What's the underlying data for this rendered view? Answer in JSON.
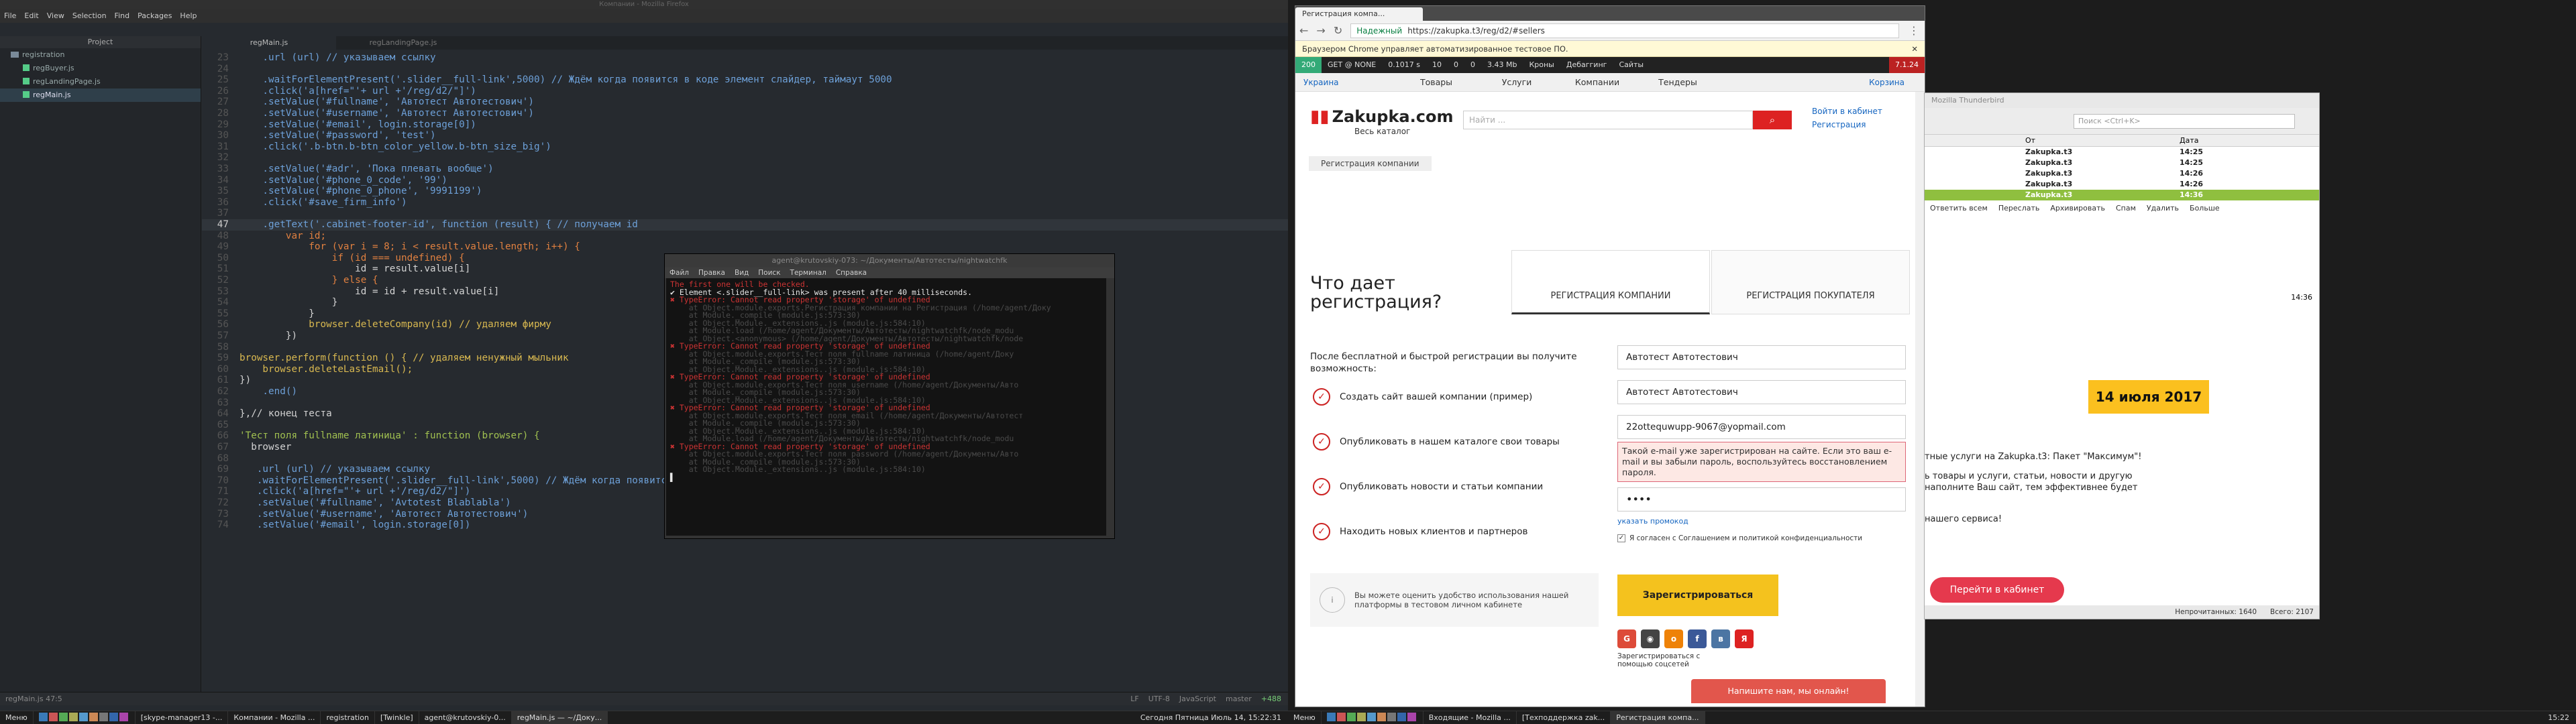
{
  "atom": {
    "window_title": "Компании - Mozilla Firefox",
    "menu": [
      "File",
      "Edit",
      "View",
      "Selection",
      "Find",
      "Packages",
      "Help"
    ],
    "tree_title": "Project",
    "tree": {
      "folder": "registration",
      "files": [
        "regBuyer.js",
        "regLandingPage.js",
        "regMain.js"
      ]
    },
    "tabs": [
      "regMain.js",
      "regLandingPage.js"
    ],
    "status_left": "regMain.js   47:5",
    "status_right": [
      "LF",
      "UTF-8",
      "JavaScript",
      "master",
      "+488"
    ],
    "code": [
      {
        "n": "23",
        "t": "    .url (url) // указываем ссылку"
      },
      {
        "n": "24",
        "t": ""
      },
      {
        "n": "25",
        "t": "    .waitForElementPresent('.slider__full-link',5000) // Ждём когда появится в коде элемент слайдер, таймаут 5000"
      },
      {
        "n": "26",
        "t": "    .click('a[href=\"'+ url +'/reg/d2/\"]')"
      },
      {
        "n": "27",
        "t": "    .setValue('#fullname', 'Автотест Автотестович')"
      },
      {
        "n": "28",
        "t": "    .setValue('#username', 'Автотест Автотестович')"
      },
      {
        "n": "29",
        "t": "    .setValue('#email', login.storage[0])"
      },
      {
        "n": "30",
        "t": "    .setValue('#password', 'test')"
      },
      {
        "n": "31",
        "t": "    .click('.b-btn.b-btn_color_yellow.b-btn_size_big')"
      },
      {
        "n": "32",
        "t": ""
      },
      {
        "n": "33",
        "t": "    .setValue('#adr', 'Пока плевать вообще')"
      },
      {
        "n": "34",
        "t": "    .setValue('#phone_0_code', '99')"
      },
      {
        "n": "35",
        "t": "    .setValue('#phone_0_phone', '9991199')"
      },
      {
        "n": "36",
        "t": "    .click('#save_firm_info')"
      },
      {
        "n": "37",
        "t": ""
      },
      {
        "n": "47",
        "t": "    .getText('.cabinet-footer-id', function (result) { // получаем id"
      },
      {
        "n": "48",
        "t": "        var id;"
      },
      {
        "n": "49",
        "t": "            for (var i = 8; i < result.value.length; i++) {"
      },
      {
        "n": "50",
        "t": "                if (id === undefined) {"
      },
      {
        "n": "51",
        "t": "                    id = result.value[i]"
      },
      {
        "n": "52",
        "t": "                } else {"
      },
      {
        "n": "53",
        "t": "                    id = id + result.value[i]"
      },
      {
        "n": "54",
        "t": "                }"
      },
      {
        "n": "55",
        "t": "            }"
      },
      {
        "n": "56",
        "t": "            browser.deleteCompany(id) // удаляем фирму"
      },
      {
        "n": "57",
        "t": "        })"
      },
      {
        "n": "58",
        "t": ""
      },
      {
        "n": "59",
        "t": "browser.perform(function () { // удаляем ненужный мыльник"
      },
      {
        "n": "60",
        "t": "    browser.deleteLastEmail();"
      },
      {
        "n": "61",
        "t": "})"
      },
      {
        "n": "62",
        "t": "    .end()"
      },
      {
        "n": "63",
        "t": ""
      },
      {
        "n": "64",
        "t": "},// конец теста"
      },
      {
        "n": "65",
        "t": ""
      },
      {
        "n": "66",
        "t": "'Тест поля fullname латиница' : function (browser) {"
      },
      {
        "n": "67",
        "t": "  browser"
      },
      {
        "n": "68",
        "t": ""
      },
      {
        "n": "69",
        "t": "   .url (url) // указываем ссылку"
      },
      {
        "n": "70",
        "t": "   .waitForElementPresent('.slider__full-link',5000) // Ждём когда появится в коде элемент слайдер, таймаут 5000"
      },
      {
        "n": "71",
        "t": "   .click('a[href=\"'+ url +'/reg/d2/\"]')"
      },
      {
        "n": "72",
        "t": "   .setValue('#fullname', 'Avtotest Blablabla')"
      },
      {
        "n": "73",
        "t": "   .setValue('#username', 'Автотест Автотестович')"
      },
      {
        "n": "74",
        "t": "   .setValue('#email', login.storage[0])"
      }
    ]
  },
  "terminal": {
    "title": "agent@krutovskiy-073: ~/Документы/Автотесты/nightwatchfk",
    "menu": [
      "Файл",
      "Правка",
      "Вид",
      "Поиск",
      "Терминал",
      "Справка"
    ],
    "lines": [
      {
        "c": "err",
        "t": "The first one will be checked."
      },
      {
        "c": "ok",
        "t": "✔ Element <.slider__full-link> was present after 40 milliseconds."
      },
      {
        "c": "err",
        "t": "✖ TypeError: Cannot read property 'storage' of undefined"
      },
      {
        "c": "dim",
        "t": "    at Object.module.exports.Регистрация компании на Регистрация (/home/agent/Доку"
      },
      {
        "c": "dim",
        "t": "    at Module._compile (module.js:573:30)"
      },
      {
        "c": "dim",
        "t": "    at Object.Module._extensions..js (module.js:584:10)"
      },
      {
        "c": "dim",
        "t": "    at Module.load (/home/agent/Документы/Автотесты/nightwatchfk/node_modu"
      },
      {
        "c": "dim",
        "t": "    at Object.<anonymous> (/home/agent/Документы/Автотесты/nightwatchfk/node"
      },
      {
        "c": "err",
        "t": "✖ TypeError: Cannot read property 'storage' of undefined"
      },
      {
        "c": "dim",
        "t": "    at Object.module.exports.Тест поля fullname латиница (/home/agent/Доку"
      },
      {
        "c": "dim",
        "t": "    at Module._compile (module.js:573:30)"
      },
      {
        "c": "dim",
        "t": "    at Object.Module._extensions..js (module.js:584:10)"
      },
      {
        "c": "err",
        "t": "✖ TypeError: Cannot read property 'storage' of undefined"
      },
      {
        "c": "dim",
        "t": "    at Object.module.exports.Тест поля username (/home/agent/Документы/Авто"
      },
      {
        "c": "dim",
        "t": "    at Module._compile (module.js:573:30)"
      },
      {
        "c": "dim",
        "t": "    at Object.Module._extensions..js (module.js:584:10)"
      },
      {
        "c": "err",
        "t": "✖ TypeError: Cannot read property 'storage' of undefined"
      },
      {
        "c": "dim",
        "t": "    at Object.module.exports.Тест поля email (/home/agent/Документы/Автотест"
      },
      {
        "c": "dim",
        "t": "    at Module._compile (module.js:573:30)"
      },
      {
        "c": "dim",
        "t": "    at Object.Module._extensions..js (module.js:584:10)"
      },
      {
        "c": "dim",
        "t": "    at Module.load (/home/agent/Документы/Автотесты/nightwatchfk/node_modu"
      },
      {
        "c": "err",
        "t": "✖ TypeError: Cannot read property 'storage' of undefined"
      },
      {
        "c": "dim",
        "t": "    at Object.module.exports.Тест поля password (/home/agent/Документы/Авто"
      },
      {
        "c": "dim",
        "t": "    at Module._compile (module.js:573:30)"
      },
      {
        "c": "dim",
        "t": "    at Object.Module._extensions..js (module.js:584:10)"
      },
      {
        "c": "ok",
        "t": "▌"
      }
    ]
  },
  "chrome": {
    "tab_title": "Регистрация компа...",
    "url_secure": "Надежный",
    "url": "https://zakupka.t3/reg/d2/#sellers",
    "info_bar": "Браузером Chrome управляет автоматизированное тестовое ПО.",
    "devbar": [
      "200",
      "GET @ NONE",
      "0.1017 s",
      "10",
      "0",
      "0",
      "3.43 Mb",
      "Кроны",
      "Дебаггинг",
      "Сайты",
      "7.1.24"
    ],
    "region": "Украина",
    "main_nav": [
      "Товары",
      "Услуги",
      "Компании",
      "Тендеры"
    ],
    "cart": "Корзина",
    "logo": "Zakupka.com",
    "catalog": "Весь каталог",
    "search_placeholder": "Найти ...",
    "login": "Войти в кабинет",
    "register": "Регистрация",
    "breadcrumb": "Регистрация компании",
    "heading": "Что дает регистрация?",
    "tab_company": "РЕГИСТРАЦИЯ КОМПАНИИ",
    "tab_buyer": "РЕГИСТРАЦИЯ ПОКУПАТЕЛЯ",
    "intro": "После бесплатной и быстрой регистрации вы получите возможность:",
    "benefits": [
      "Создать сайт вашей компании (пример)",
      "Опубликовать в нашем каталоге свои товары",
      "Опубликовать новости и статьи компании",
      "Находить новых клиентов и партнеров"
    ],
    "note": "Вы можете оценить удобство использования нашей платформы в тестовом личном кабинете",
    "fullname": "Автотест Автотестович",
    "username": "Автотест Автотестович",
    "email": "22ottequwupp-9067@yopmail.com",
    "error": "Такой e-mail уже зарегистрирован на сайте. Если это ваш e-mail и вы забыли пароль, воспользуйтесь восстановлением пароля.",
    "password": "••••",
    "promo_link": "указать промокод",
    "agree": "Я согласен с Соглашением и политикой конфиденциальности",
    "register_btn": "Зарегистрироваться",
    "social_text": "Зарегистрироваться с помощью соцсетей",
    "chat": "Напишите нам, мы онлайн!"
  },
  "thunderbird": {
    "title": "Mozilla Thunderbird",
    "search_placeholder": "Поиск <Ctrl+K>",
    "col_from": "От",
    "col_date": "Дата",
    "messages": [
      {
        "from": "Zakupka.t3",
        "date": "14:25"
      },
      {
        "from": "Zakupka.t3",
        "date": "14:25"
      },
      {
        "from": "Zakupka.t3",
        "date": "14:26"
      },
      {
        "from": "Zakupka.t3",
        "date": "14:26"
      },
      {
        "from": "Zakupka.t3",
        "date": "14:36"
      }
    ],
    "actions": [
      "Ответить всем",
      "Переслать",
      "Архивировать",
      "Спам",
      "Удалить",
      "Больше"
    ],
    "time": "14:36",
    "date_badge": "14 июля 2017",
    "body": [
      "тные услуги на Zakupka.t3: Пакет \"Максимум\"!",
      "ь товары и услуги, статьи, новости и другую",
      "наполните Ваш сайт, тем эффективнее будет",
      "нашего сервиса!"
    ],
    "cta": "Перейти в кабинет",
    "status_unread": "Непрочитанных: 1640",
    "status_total": "Всего: 2107"
  },
  "taskbar_left": {
    "menu": "Меню",
    "tasks": [
      "[skype-manager13 -...",
      "Компании - Mozilla ...",
      "registration",
      "[Twinkle]",
      "agent@krutovskiy-0...",
      "regMain.js — ~/Доку..."
    ],
    "clock": "Сегодня Пятница Июль 14, 15:22:31"
  },
  "taskbar_right": {
    "menu": "Меню",
    "tasks": [
      "Входящие - Mozilla ...",
      "[Техподдержка zak...",
      "Регистрация компа..."
    ],
    "clock": "15:22"
  }
}
